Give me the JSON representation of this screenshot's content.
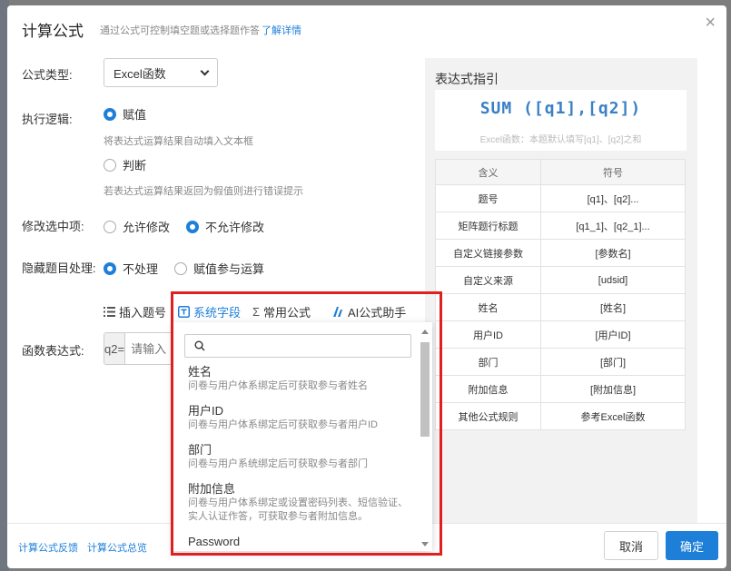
{
  "dialog": {
    "title": "计算公式",
    "subtitle": "通过公式可控制填空题或选择题作答",
    "learn_more": "了解详情",
    "close": "×"
  },
  "form": {
    "formula_type_label": "公式类型:",
    "formula_type_value": "Excel函数",
    "exec_logic_label": "执行逻辑:",
    "assign_label": "赋值",
    "assign_hint": "将表达式运算结果自动填入文本框",
    "judge_label": "判断",
    "judge_hint": "若表达式运算结果返回为假值则进行错误提示",
    "modify_label": "修改选中项:",
    "allow_modify": "允许修改",
    "disallow_modify": "不允许修改",
    "hidden_label": "隐藏题目处理:",
    "no_process": "不处理",
    "assign_participate": "赋值参与运算",
    "expr_label": "函数表达式:",
    "expr_prefix": "q2=",
    "expr_placeholder": "请输入"
  },
  "toolbar": {
    "insert_question": "插入题号",
    "system_fields": "系统字段",
    "common_formulas": "常用公式",
    "ai_assistant": "AI公式助手"
  },
  "guide": {
    "title": "表达式指引",
    "formula": "SUM ([q1],[q2])",
    "formula_note": "Excel函数：本题默认填写[q1]、[q2]之和",
    "headers": [
      "含义",
      "符号"
    ],
    "rows": [
      [
        "题号",
        "[q1]、[q2]..."
      ],
      [
        "矩阵题行标题",
        "[q1_1]、[q2_1]..."
      ],
      [
        "自定义链接参数",
        "[参数名]"
      ],
      [
        "自定义来源",
        "[udsid]"
      ],
      [
        "姓名",
        "[姓名]"
      ],
      [
        "用户ID",
        "[用户ID]"
      ],
      [
        "部门",
        "[部门]"
      ],
      [
        "附加信息",
        "[附加信息]"
      ],
      [
        "其他公式规则",
        "参考Excel函数"
      ]
    ]
  },
  "dropdown": {
    "search_placeholder": "",
    "items": [
      {
        "name": "姓名",
        "desc": "问卷与用户体系绑定后可获取参与者姓名"
      },
      {
        "name": "用户ID",
        "desc": "问卷与用户体系绑定后可获取参与者用户ID"
      },
      {
        "name": "部门",
        "desc": "问卷与用户系统绑定后可获取参与者部门"
      },
      {
        "name": "附加信息",
        "desc": "问卷与用户体系绑定或设置密码列表、短信验证、实人认证作答，可获取参与者附加信息。"
      },
      {
        "name": "Password",
        "desc": ""
      }
    ]
  },
  "footer": {
    "feedback": "计算公式反馈",
    "overview": "计算公式总览",
    "cancel": "取消",
    "ok": "确定"
  },
  "colors": {
    "accent": "#1e7fd9",
    "highlight": "#e02020",
    "formula": "#3a80c4"
  },
  "icons": {
    "close": "close-icon",
    "chevron": "chevron-down-icon",
    "insert_question": "list-icon",
    "system_fields": "field-icon",
    "common_formulas": "sigma-icon",
    "ai_assistant": "ai-icon",
    "search": "search-icon"
  }
}
